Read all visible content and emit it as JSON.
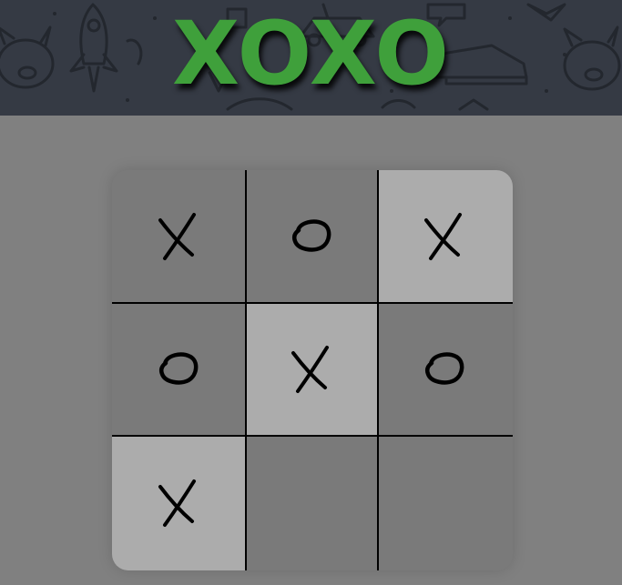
{
  "title": "XOXO",
  "colors": {
    "title": "#3fa03b",
    "header_bg": "#353a44",
    "page_bg": "#808080",
    "cell_default": "#7a7a7a",
    "cell_highlight": "#acacac",
    "grid_line": "#000000"
  },
  "board": {
    "cells": [
      {
        "mark": "X",
        "highlighted": false
      },
      {
        "mark": "O",
        "highlighted": false
      },
      {
        "mark": "X",
        "highlighted": true
      },
      {
        "mark": "O",
        "highlighted": false
      },
      {
        "mark": "X",
        "highlighted": true
      },
      {
        "mark": "O",
        "highlighted": false
      },
      {
        "mark": "X",
        "highlighted": true
      },
      {
        "mark": "",
        "highlighted": false
      },
      {
        "mark": "",
        "highlighted": false
      }
    ]
  }
}
